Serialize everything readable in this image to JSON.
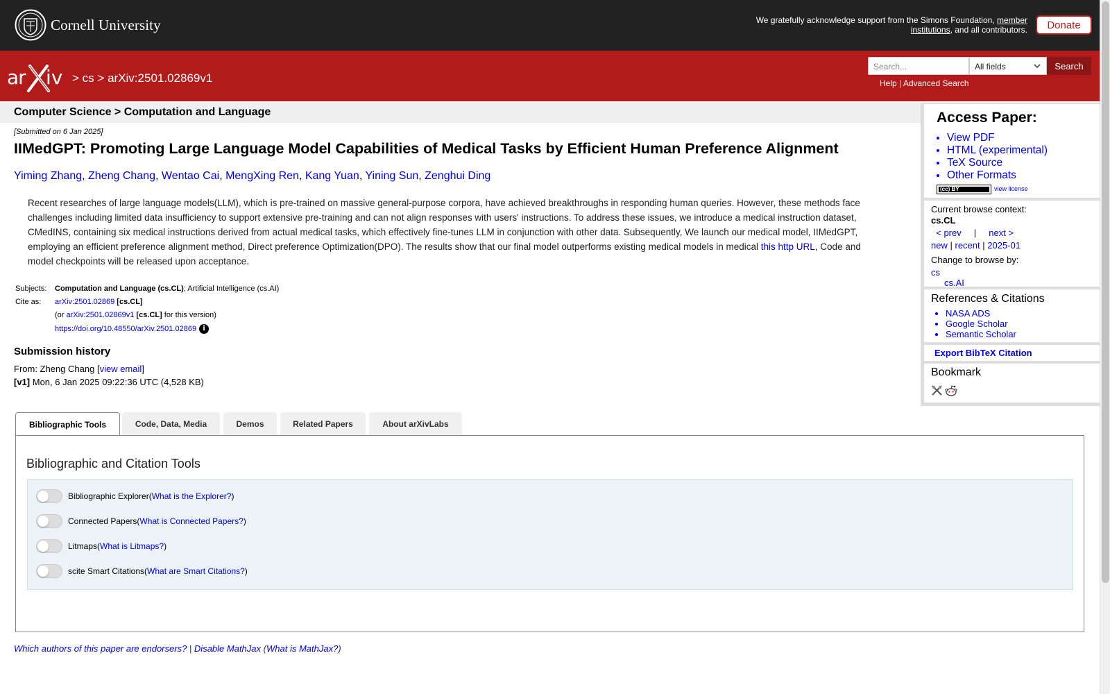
{
  "topbar": {
    "cornell": "Cornell University",
    "support_text": "We gratefully acknowledge support from the Simons Foundation, ",
    "support_link": "member institutions",
    "support_tail": ", and all contributors.",
    "donate": "Donate"
  },
  "redbar": {
    "crumb_sep1": ">",
    "crumb_cs": "cs",
    "crumb_sep2": ">",
    "crumb_id": "arXiv:2501.02869v1",
    "search_placeholder": "Search...",
    "search_field": "All fields",
    "search_button": "Search",
    "help": "Help",
    "link_sep": "|",
    "advanced": "Advanced Search"
  },
  "paper": {
    "category_header": "Computer Science > Computation and Language",
    "submitted": "[Submitted on 6 Jan 2025]",
    "title": "IIMedGPT: Promoting Large Language Model Capabilities of Medical Tasks by Efficient Human Preference Alignment",
    "authors": [
      "Yiming Zhang",
      "Zheng Chang",
      "Wentao Cai",
      "MengXing Ren",
      "Kang Yuan",
      "Yining Sun",
      "Zenghui Ding"
    ],
    "abstract_before": "Recent researches of large language models(LLM), which is pre-trained on massive general-purpose corpora, have achieved breakthroughs in responding human queries. However, these methods face challenges including limited data insufficiency to support extensive pre-training and can not align responses with users' instructions. To address these issues, we introduce a medical instruction dataset, CMedINS, containing six medical instructions derived from actual medical tasks, which effectively fine-tunes LLM in conjunction with other data. Subsequently, We launch our medical model, IIMedGPT, employing an efficient preference alignment method, Direct preference Optimization(DPO). The results show that our final model outperforms existing medical models in medical ",
    "abstract_link": "this http URL",
    "abstract_after": ", Code and model checkpoints will be released upon acceptance.",
    "subjects_label": "Subjects:",
    "subjects_bold": "Computation and Language (cs.CL)",
    "subjects_rest": "; Artificial Intelligence (cs.AI)",
    "cite_label": "Cite as:",
    "cite_id": "arXiv:2501.02869",
    "cite_cat": "[cs.CL]",
    "cite_or": "(or ",
    "cite_v1": "arXiv:2501.02869v1",
    "cite_v1_cat": "[cs.CL]",
    "cite_v1_tail": " for this version)",
    "doi": "https://doi.org/10.48550/arXiv.2501.02869",
    "doi_info": "i",
    "history_title": "Submission history",
    "from_label": "From: Zheng Chang [",
    "view_email": "view email",
    "from_close": "]",
    "v1_label": "[v1]",
    "v1_text": " Mon, 6 Jan 2025 09:22:36 UTC (4,528 KB)"
  },
  "sidebar": {
    "access_title": "Access Paper:",
    "access_links": [
      "View PDF",
      "HTML (experimental)",
      "TeX Source",
      "Other Formats"
    ],
    "cc_badge": "(cc) BY",
    "view_license": "view license",
    "context_label": "Current browse context:",
    "context_value": "cs.CL",
    "prev": "< prev",
    "nav_sep": "|",
    "next": "next >",
    "new": "new",
    "recent": "recent",
    "month": "2025-01",
    "change_label": "Change to browse by:",
    "browse_cs": "cs",
    "browse_csai": "cs.AI",
    "refs_title": "References & Citations",
    "refs_links": [
      "NASA ADS",
      "Google Scholar",
      "Semantic Scholar"
    ],
    "bibtex": "Export BibTeX Citation",
    "bookmark_title": "Bookmark"
  },
  "tabs": {
    "items": [
      "Bibliographic Tools",
      "Code, Data, Media",
      "Demos",
      "Related Papers",
      "About arXivLabs"
    ],
    "panel_title": "Bibliographic and Citation Tools",
    "tools": [
      {
        "label": "Bibliographic Explorer",
        "help": "What is the Explorer?"
      },
      {
        "label": "Connected Papers",
        "help": "What is Connected Papers?"
      },
      {
        "label": "Litmaps",
        "help": "What is Litmaps?"
      },
      {
        "label": "scite Smart Citations",
        "help": "What are Smart Citations?"
      }
    ],
    "open_paren": " (",
    "close_paren": ")"
  },
  "footer": {
    "endorsers": "Which authors of this paper are endorsers?",
    "sep": " | ",
    "disable_mathjax": "Disable MathJax",
    "what_open": " (",
    "what_mathjax": "What is MathJax?",
    "what_close": ")"
  },
  "colors": {
    "arxiv_red": "#b31b1b",
    "cornell_bar": "#222222",
    "link_blue": "#0000ee"
  }
}
